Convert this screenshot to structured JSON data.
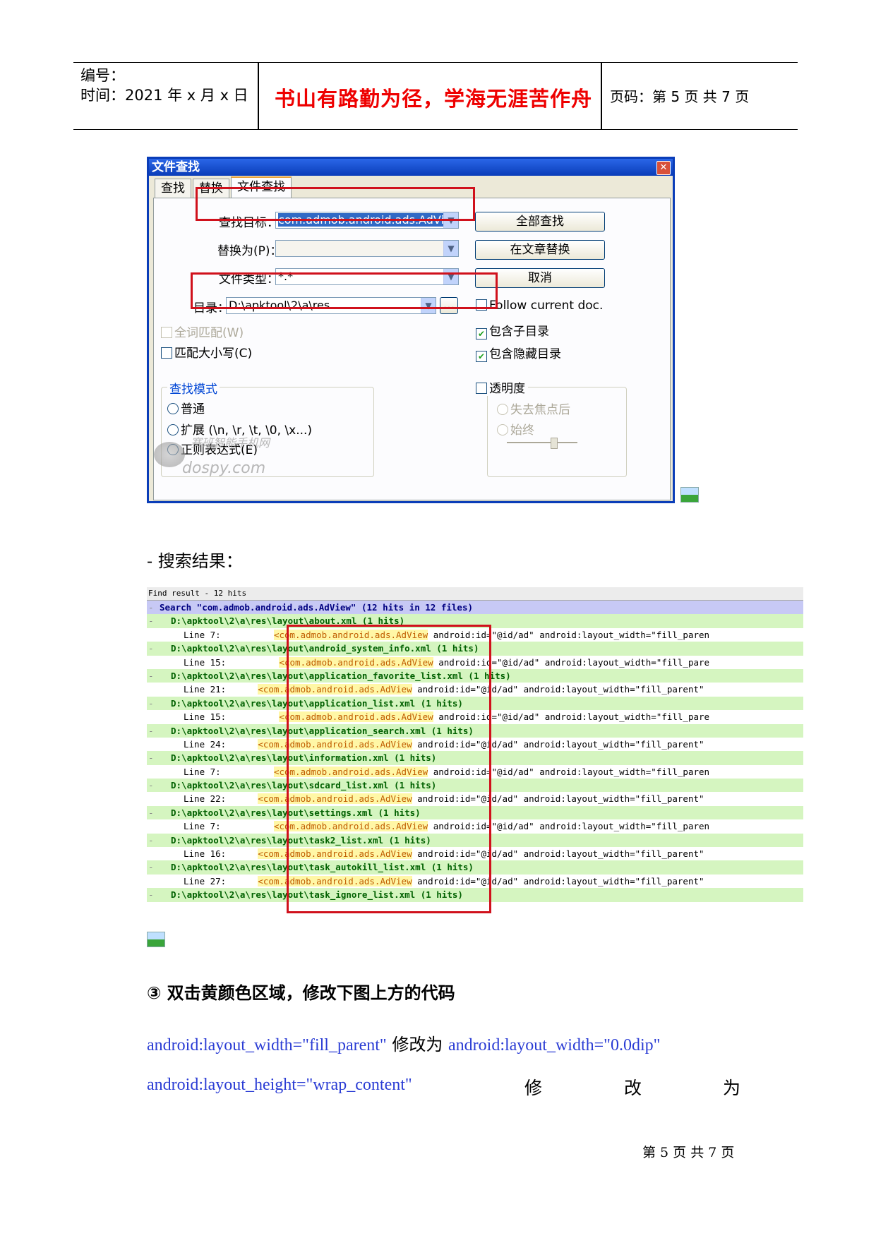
{
  "header": {
    "number_label": "编号：",
    "time_label": "时间：2021 年 x 月 x 日",
    "motto": "书山有路勤为径，学海无涯苦作舟",
    "page_label": "页码：第 5 页  共 7 页"
  },
  "dialog": {
    "title": "文件查找",
    "tabs": [
      "查找",
      "替换",
      "文件查找"
    ],
    "find_target_label": "查找目标：",
    "find_target_value": "com.admob.android.ads.AdView",
    "replace_label": "替换为(P)：",
    "replace_value": "",
    "file_type_label": "文件类型：",
    "file_type_value": "*.*",
    "dir_label": "目录：",
    "dir_value": "D:\\apktool\\2\\a\\res",
    "browse_label": "...",
    "btn_find_all": "全部查找",
    "btn_replace_in_files": "在文章替换",
    "btn_cancel": "取消",
    "follow_current": "Follow current doc.",
    "include_subdirs": "包含子目录",
    "include_hidden": "包含隐藏目录",
    "whole_word": "全词匹配(W)",
    "match_case": "匹配大小写(C)",
    "search_mode_title": "查找模式",
    "mode_normal": "普通",
    "mode_extended": "扩展 (\\n, \\r, \\t, \\0, \\x...)",
    "mode_regex": "正则表达式(E)",
    "transparency": "透明度",
    "on_lose_focus": "失去焦点后",
    "always": "始终",
    "watermark_cn": "赛班智能手机网",
    "watermark_en": "dospy.com"
  },
  "results_heading": "- 搜索结果：",
  "results": {
    "title_bar": "Find result - 12 hits",
    "search_line": "Search \"com.admob.android.ads.AdView\" (12 hits in 12 files)",
    "rows": [
      {
        "type": "file",
        "text": "D:\\apktool\\2\\a\\res\\layout\\about.xml (1 hits)"
      },
      {
        "type": "line",
        "pre": "Line 7:          ",
        "hl": "<com.admob.android.ads.AdView",
        "post": " android:id=\"@id/ad\" android:layout_width=\"fill_paren"
      },
      {
        "type": "file",
        "text": "D:\\apktool\\2\\a\\res\\layout\\android_system_info.xml (1 hits)"
      },
      {
        "type": "line",
        "pre": "Line 15:          ",
        "hl": "<com.admob.android.ads.AdView",
        "post": " android:id=\"@id/ad\" android:layout_width=\"fill_pare"
      },
      {
        "type": "file",
        "text": "D:\\apktool\\2\\a\\res\\layout\\application_favorite_list.xml (1 hits)"
      },
      {
        "type": "line",
        "pre": "Line 21:      ",
        "hl": "<com.admob.android.ads.AdView",
        "post": " android:id=\"@id/ad\" android:layout_width=\"fill_parent\""
      },
      {
        "type": "file",
        "text": "D:\\apktool\\2\\a\\res\\layout\\application_list.xml (1 hits)"
      },
      {
        "type": "line",
        "pre": "Line 15:          ",
        "hl": "<com.admob.android.ads.AdView",
        "post": " android:id=\"@id/ad\" android:layout_width=\"fill_pare"
      },
      {
        "type": "file",
        "text": "D:\\apktool\\2\\a\\res\\layout\\application_search.xml (1 hits)"
      },
      {
        "type": "line",
        "pre": "Line 24:      ",
        "hl": "<com.admob.android.ads.AdView",
        "post": " android:id=\"@id/ad\" android:layout_width=\"fill_parent\""
      },
      {
        "type": "file",
        "text": "D:\\apktool\\2\\a\\res\\layout\\information.xml (1 hits)"
      },
      {
        "type": "line",
        "pre": "Line 7:          ",
        "hl": "<com.admob.android.ads.AdView",
        "post": " android:id=\"@id/ad\" android:layout_width=\"fill_paren"
      },
      {
        "type": "file",
        "text": "D:\\apktool\\2\\a\\res\\layout\\sdcard_list.xml (1 hits)"
      },
      {
        "type": "line",
        "pre": "Line 22:      ",
        "hl": "<com.admob.android.ads.AdView",
        "post": " android:id=\"@id/ad\" android:layout_width=\"fill_parent\""
      },
      {
        "type": "file",
        "text": "D:\\apktool\\2\\a\\res\\layout\\settings.xml (1 hits)"
      },
      {
        "type": "line",
        "pre": "Line 7:          ",
        "hl": "<com.admob.android.ads.AdView",
        "post": " android:id=\"@id/ad\" android:layout_width=\"fill_paren"
      },
      {
        "type": "file",
        "text": "D:\\apktool\\2\\a\\res\\layout\\task2_list.xml (1 hits)"
      },
      {
        "type": "line",
        "pre": "Line 16:      ",
        "hl": "<com.admob.android.ads.AdView",
        "post": " android:id=\"@id/ad\" android:layout_width=\"fill_parent\""
      },
      {
        "type": "file",
        "text": "D:\\apktool\\2\\a\\res\\layout\\task_autokill_list.xml (1 hits)"
      },
      {
        "type": "line",
        "pre": "Line 27:      ",
        "hl": "<com.admob.android.ads.AdView",
        "post": " android:id=\"@id/ad\" android:layout_width=\"fill_parent\""
      },
      {
        "type": "file",
        "text": "D:\\apktool\\2\\a\\res\\layout\\task_ignore_list.xml (1 hits)"
      }
    ]
  },
  "step3": "③ 双击黄颜色区域，修改下图上方的代码",
  "line1_a": "android:layout_width=\"fill_parent\"",
  "line1_mid": " 修改为 ",
  "line1_b": "android:layout_width=\"0.0dip\"",
  "line2_a": "android:layout_height=\"wrap_content\"",
  "line2_chars": [
    "修",
    "改",
    "为"
  ],
  "footer": "第 5 页 共 7 页"
}
